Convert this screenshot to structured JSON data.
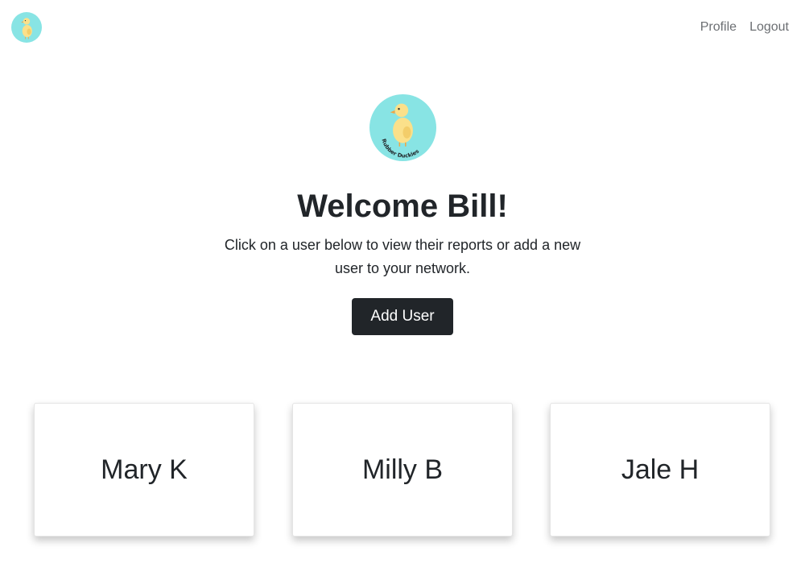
{
  "navbar": {
    "logo_icon": "rubber-duck-logo-icon",
    "links": [
      {
        "label": "Profile"
      },
      {
        "label": "Logout"
      }
    ]
  },
  "hero": {
    "logo_icon": "rubber-duck-logo-icon",
    "logo_text": "Rubber Duckies",
    "title": "Welcome Bill!",
    "subtitle": "Click on a user below to view their reports or add a new user to your network.",
    "add_user_label": "Add User"
  },
  "users": [
    {
      "name": "Mary K"
    },
    {
      "name": "Milly B"
    },
    {
      "name": "Jale H"
    }
  ],
  "colors": {
    "logo_bg": "#88e4e4",
    "duck_body": "#fbe08a",
    "button_bg": "#212529",
    "text": "#212529",
    "nav_link": "#6c6f73"
  }
}
